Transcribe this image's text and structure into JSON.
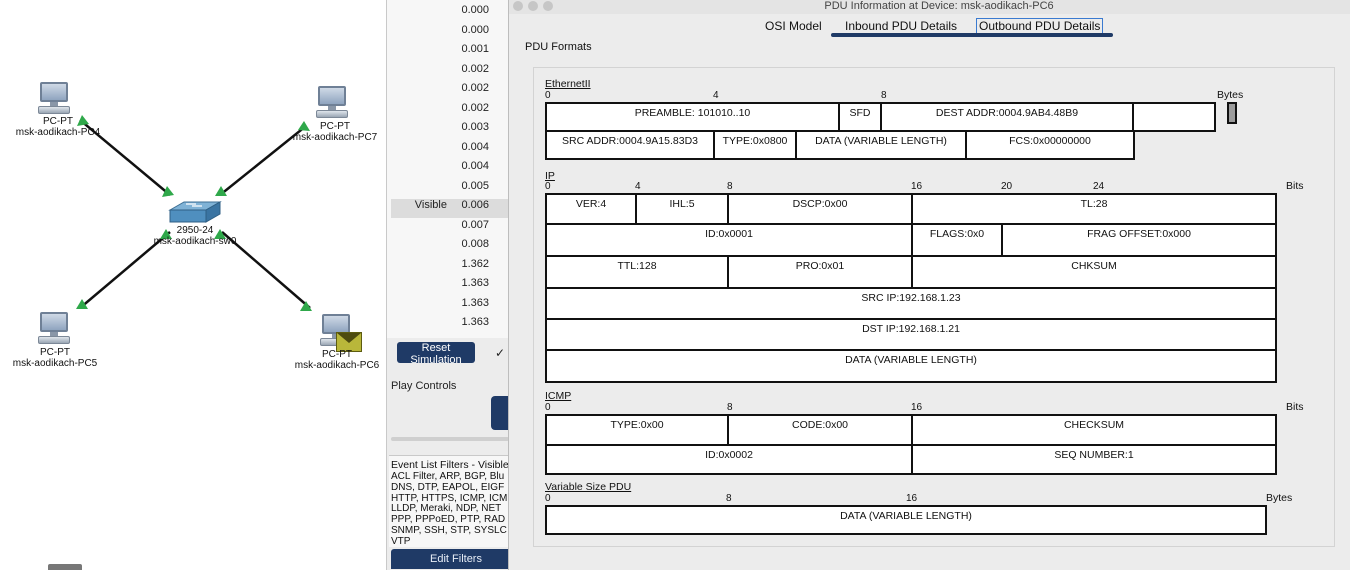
{
  "topology": {
    "devices": [
      {
        "type": "PC-PT",
        "name": "msk-aodikach-PC4"
      },
      {
        "type": "PC-PT",
        "name": "msk-aodikach-PC7"
      },
      {
        "type": "2950-24",
        "name": "msk-aodikach-sw0"
      },
      {
        "type": "PC-PT",
        "name": "msk-aodikach-PC5"
      },
      {
        "type": "PC-PT",
        "name": "msk-aodikach-PC6"
      }
    ],
    "link_color": "#111111",
    "link_end_color": "#2fa84a"
  },
  "simulation": {
    "events": [
      {
        "visible": "",
        "time": "0.000"
      },
      {
        "visible": "",
        "time": "0.000"
      },
      {
        "visible": "",
        "time": "0.001"
      },
      {
        "visible": "",
        "time": "0.002"
      },
      {
        "visible": "",
        "time": "0.002"
      },
      {
        "visible": "",
        "time": "0.002"
      },
      {
        "visible": "",
        "time": "0.003"
      },
      {
        "visible": "",
        "time": "0.004"
      },
      {
        "visible": "",
        "time": "0.004"
      },
      {
        "visible": "",
        "time": "0.005"
      },
      {
        "visible": "Visible",
        "time": "0.006"
      },
      {
        "visible": "",
        "time": "0.007"
      },
      {
        "visible": "",
        "time": "0.008"
      },
      {
        "visible": "",
        "time": "1.362"
      },
      {
        "visible": "",
        "time": "1.363"
      },
      {
        "visible": "",
        "time": "1.363"
      },
      {
        "visible": "",
        "time": "1.363"
      }
    ],
    "reset_label": "Reset Simulation",
    "check_mark": "✓",
    "play_controls_label": "Play Controls",
    "filters_title": "Event List Filters - Visible",
    "filters_text": "ACL Filter, ARP, BGP, Blu\nDNS, DTP, EAPOL, EIGF\nHTTP, HTTPS, ICMP, ICM\nLLDP, Meraki, NDP, NET\nPPP, PPPoED, PTP, RAD\nSNMP, SSH, STP, SYSLC\nVTP",
    "edit_filters_label": "Edit Filters",
    "button_color": "#1f3a66"
  },
  "pdu_window": {
    "title": "PDU Information at Device: msk-aodikach-PC6",
    "tabs": [
      {
        "label": "OSI Model",
        "active": false
      },
      {
        "label": "Inbound PDU Details",
        "active": false
      },
      {
        "label": "Outbound PDU Details",
        "active": true
      }
    ],
    "formats_label": "PDU Formats",
    "ethernet": {
      "title": "EthernetII",
      "ruler": [
        "0",
        "4",
        "8"
      ],
      "unit": "Bytes",
      "row1": {
        "preamble": "PREAMBLE: 101010..10",
        "sfd": "SFD",
        "dest": "DEST ADDR:0004.9AB4.48B9"
      },
      "row2": {
        "src": "SRC ADDR:0004.9A15.83D3",
        "type": "TYPE:0x0800",
        "data": "DATA (VARIABLE LENGTH)",
        "fcs": "FCS:0x00000000"
      }
    },
    "ip": {
      "title": "IP",
      "ruler": [
        "0",
        "4",
        "8",
        "16",
        "20",
        "24"
      ],
      "unit": "Bits",
      "row1": {
        "ver": "VER:4",
        "ihl": "IHL:5",
        "dscp": "DSCP:0x00",
        "tl": "TL:28"
      },
      "row2": {
        "id": "ID:0x0001",
        "flags": "FLAGS:0x0",
        "frag": "FRAG OFFSET:0x000"
      },
      "row3": {
        "ttl": "TTL:128",
        "pro": "PRO:0x01",
        "chksum": "CHKSUM"
      },
      "src_ip": "SRC IP:192.168.1.23",
      "dst_ip": "DST IP:192.168.1.21",
      "data": "DATA (VARIABLE LENGTH)"
    },
    "icmp": {
      "title": "ICMP",
      "ruler": [
        "0",
        "8",
        "16"
      ],
      "unit": "Bits",
      "row1": {
        "type": "TYPE:0x00",
        "code": "CODE:0x00",
        "checksum": "CHECKSUM"
      },
      "row2": {
        "id": "ID:0x0002",
        "seq": "SEQ NUMBER:1"
      }
    },
    "variable": {
      "title": "Variable Size PDU",
      "ruler": [
        "0",
        "8",
        "16"
      ],
      "unit": "Bytes",
      "data": "DATA (VARIABLE LENGTH)"
    }
  }
}
